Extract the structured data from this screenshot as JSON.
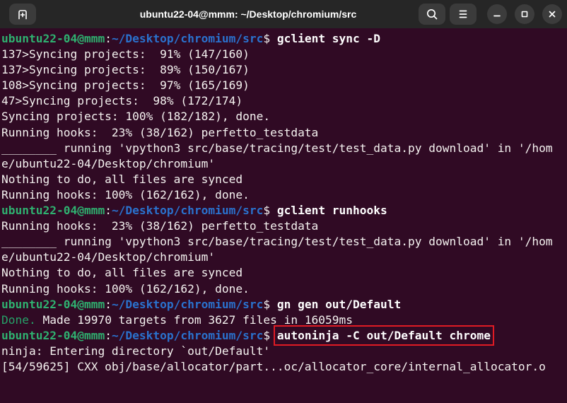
{
  "colors": {
    "terminal_bg": "#300a24",
    "header_bg": "#262626",
    "button_bg": "#3b3b3b",
    "circle_bg": "#3c3c3c",
    "text": "#f5f2f0",
    "prompt_green": "#2fb170",
    "path_blue": "#2a72ce",
    "done_green": "#26a269",
    "highlight_red": "#e01b24",
    "title_text": "#ffffff"
  },
  "window": {
    "title": "ubuntu22-04@mmm: ~/Desktop/chromium/src",
    "controls": {
      "new_tab": "new-tab-button",
      "search": "search-button",
      "menu": "menu-button",
      "minimize": "minimize-button",
      "maximize": "maximize-button",
      "close": "close-button"
    }
  },
  "terminal": {
    "prompt": {
      "user": "ubuntu22-04@mmm",
      "separator": ":",
      "path": "~/Desktop/chromium/src",
      "symbol": "$"
    },
    "commands": [
      "gclient sync -D",
      "gclient runhooks",
      "gn gen out/Default",
      "autoninja -C out/Default chrome"
    ],
    "highlighted_command": "autoninja -C out/Default chrome",
    "lines": [
      {
        "segments": [
          {
            "style": "user",
            "text": "ubuntu22-04@mmm"
          },
          {
            "style": "plain",
            "text": ":"
          },
          {
            "style": "path",
            "text": "~/Desktop/chromium/src"
          },
          {
            "style": "plain",
            "text": "$ "
          },
          {
            "style": "cmd",
            "text": "gclient sync -D"
          }
        ]
      },
      {
        "segments": [
          {
            "style": "out",
            "text": "137>Syncing projects:  91% (147/160)"
          }
        ]
      },
      {
        "segments": [
          {
            "style": "out",
            "text": "137>Syncing projects:  89% (150/167)"
          }
        ]
      },
      {
        "segments": [
          {
            "style": "out",
            "text": "108>Syncing projects:  97% (165/169)"
          }
        ]
      },
      {
        "segments": [
          {
            "style": "out",
            "text": "47>Syncing projects:  98% (172/174)"
          }
        ]
      },
      {
        "segments": [
          {
            "style": "out",
            "text": "Syncing projects: 100% (182/182), done."
          }
        ]
      },
      {
        "segments": [
          {
            "style": "out",
            "text": "Running hooks:  23% (38/162) perfetto_testdata"
          }
        ]
      },
      {
        "segments": [
          {
            "style": "out",
            "text": "________ running 'vpython3 src/base/tracing/test/test_data.py download' in '/hom"
          }
        ]
      },
      {
        "segments": [
          {
            "style": "out",
            "text": "e/ubuntu22-04/Desktop/chromium'"
          }
        ]
      },
      {
        "segments": [
          {
            "style": "out",
            "text": "Nothing to do, all files are synced"
          }
        ]
      },
      {
        "segments": [
          {
            "style": "out",
            "text": "Running hooks: 100% (162/162), done."
          }
        ]
      },
      {
        "segments": [
          {
            "style": "user",
            "text": "ubuntu22-04@mmm"
          },
          {
            "style": "plain",
            "text": ":"
          },
          {
            "style": "path",
            "text": "~/Desktop/chromium/src"
          },
          {
            "style": "plain",
            "text": "$ "
          },
          {
            "style": "cmd",
            "text": "gclient runhooks"
          }
        ]
      },
      {
        "segments": [
          {
            "style": "out",
            "text": "Running hooks:  23% (38/162) perfetto_testdata"
          }
        ]
      },
      {
        "segments": [
          {
            "style": "out",
            "text": "________ running 'vpython3 src/base/tracing/test/test_data.py download' in '/hom"
          }
        ]
      },
      {
        "segments": [
          {
            "style": "out",
            "text": "e/ubuntu22-04/Desktop/chromium'"
          }
        ]
      },
      {
        "segments": [
          {
            "style": "out",
            "text": "Nothing to do, all files are synced"
          }
        ]
      },
      {
        "segments": [
          {
            "style": "out",
            "text": "Running hooks: 100% (162/162), done."
          }
        ]
      },
      {
        "segments": [
          {
            "style": "user",
            "text": "ubuntu22-04@mmm"
          },
          {
            "style": "plain",
            "text": ":"
          },
          {
            "style": "path",
            "text": "~/Desktop/chromium/src"
          },
          {
            "style": "plain",
            "text": "$ "
          },
          {
            "style": "cmd",
            "text": "gn gen out/Default"
          }
        ]
      },
      {
        "segments": [
          {
            "style": "done",
            "text": "Done."
          },
          {
            "style": "out",
            "text": " Made 19970 targets from 3627 files in 16059ms"
          }
        ]
      },
      {
        "segments": [
          {
            "style": "user",
            "text": "ubuntu22-04@mmm"
          },
          {
            "style": "plain",
            "text": ":"
          },
          {
            "style": "path",
            "text": "~/Desktop/chromium/src"
          },
          {
            "style": "plain",
            "text": "$ "
          },
          {
            "style": "boxed",
            "text": "autoninja -C out/Default chrome"
          }
        ]
      },
      {
        "segments": [
          {
            "style": "out",
            "text": "ninja: Entering directory `out/Default'"
          }
        ]
      },
      {
        "segments": [
          {
            "style": "out",
            "text": "[54/59625] CXX obj/base/allocator/part...oc/allocator_core/internal_allocator.o"
          }
        ]
      }
    ]
  }
}
